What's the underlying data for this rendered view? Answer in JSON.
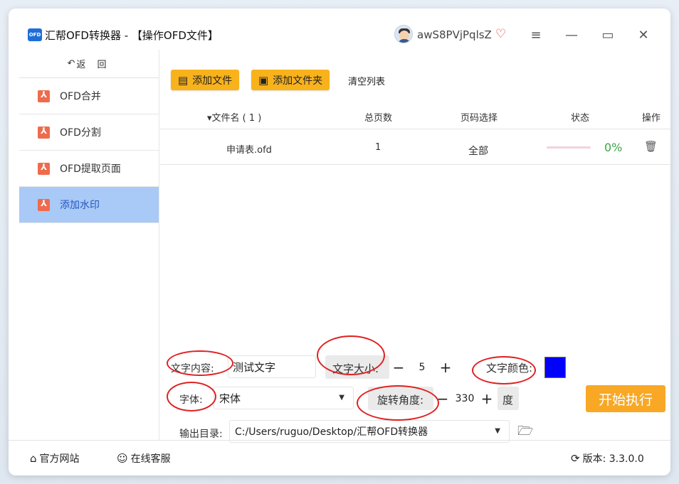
{
  "window": {
    "title": "汇帮OFD转换器 - 【操作OFD文件】",
    "logo_text": "OFD",
    "user_name": "awS8PVjPqlsZ"
  },
  "icons": {
    "vip": "♡",
    "menu": "≡",
    "minimize": "—",
    "maximize": "▭",
    "close": "✕"
  },
  "sidebar": {
    "back_label": "返 回",
    "items": [
      {
        "label": "OFD合并"
      },
      {
        "label": "OFD分割"
      },
      {
        "label": "OFD提取页面"
      },
      {
        "label": "添加水印"
      }
    ]
  },
  "toolbar": {
    "add_file": "添加文件",
    "add_folder": "添加文件夹",
    "clear_list": "清空列表"
  },
  "table": {
    "headers": [
      "▾文件名 ( 1 )",
      "总页数",
      "页码选择",
      "状态",
      "操作"
    ],
    "rows": [
      {
        "filename": "申请表.ofd",
        "pages": "1",
        "page_select": "全部",
        "progress_fraction": 0.0,
        "status_pct": "0%"
      }
    ]
  },
  "settings": {
    "text_content_label": "文字内容:",
    "text_content_value": "测试文字",
    "font_size_label": "文字大小:",
    "font_size_value": "5",
    "text_color_label": "文字颜色:",
    "text_color": "#0000ff",
    "font_label": "字体:",
    "font_value": "宋体",
    "rotation_label": "旋转角度:",
    "rotation_value": "330",
    "rotation_unit": "度",
    "output_label": "输出目录:",
    "output_path": "C:/Users/ruguo/Desktop/汇帮OFD转换器",
    "start_button": "开始执行"
  },
  "footer": {
    "website": "官方网站",
    "support": "在线客服",
    "version": "版本: 3.3.0.0"
  },
  "colors": {
    "accent": "#f8b21c",
    "start": "#f9a825",
    "active_nav": "#a9c9f6",
    "annotation": "#e02020"
  }
}
